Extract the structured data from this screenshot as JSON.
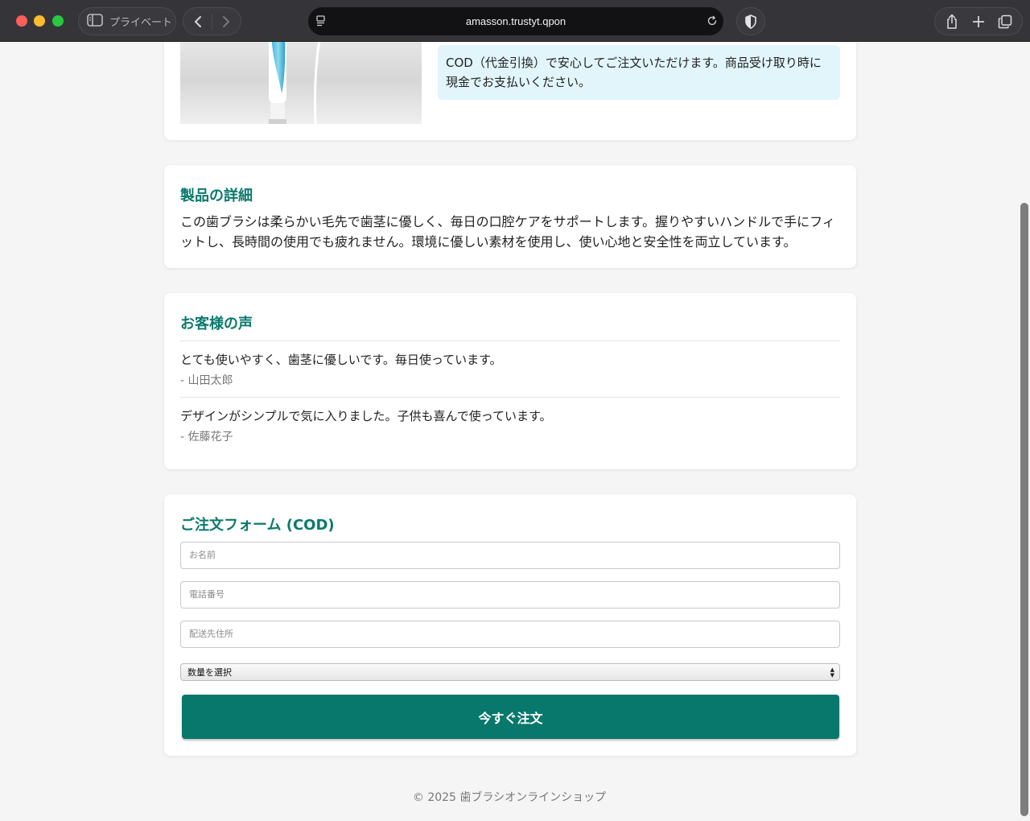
{
  "browser": {
    "private_label": "プライベート",
    "url": "amasson.trustyt.qpon"
  },
  "product": {
    "cod_note": "COD（代金引換）で安心してご注文いただけます。商品受け取り時に現金でお支払いください。"
  },
  "details": {
    "title": "製品の詳細",
    "description": "この歯ブラシは柔らかい毛先で歯茎に優しく、毎日の口腔ケアをサポートします。握りやすいハンドルで手にフィットし、長時間の使用でも疲れません。環境に優しい素材を使用し、使い心地と安全性を両立しています。"
  },
  "reviews": {
    "title": "お客様の声",
    "items": [
      {
        "text": "とても使いやすく、歯茎に優しいです。毎日使っています。",
        "author": "- 山田太郎"
      },
      {
        "text": "デザインがシンプルで気に入りました。子供も喜んで使っています。",
        "author": "- 佐藤花子"
      }
    ]
  },
  "order_form": {
    "title": "ご注文フォーム (COD)",
    "name_placeholder": "お名前",
    "phone_placeholder": "電話番号",
    "address_placeholder": "配送先住所",
    "quantity_selected": "数量を選択",
    "submit_label": "今すぐ注文"
  },
  "footer": {
    "text": "© 2025 歯ブラシオンラインショップ"
  },
  "colors": {
    "accent": "#0b7a6c",
    "button": "#07786b",
    "note_bg": "#e1f5fa"
  }
}
